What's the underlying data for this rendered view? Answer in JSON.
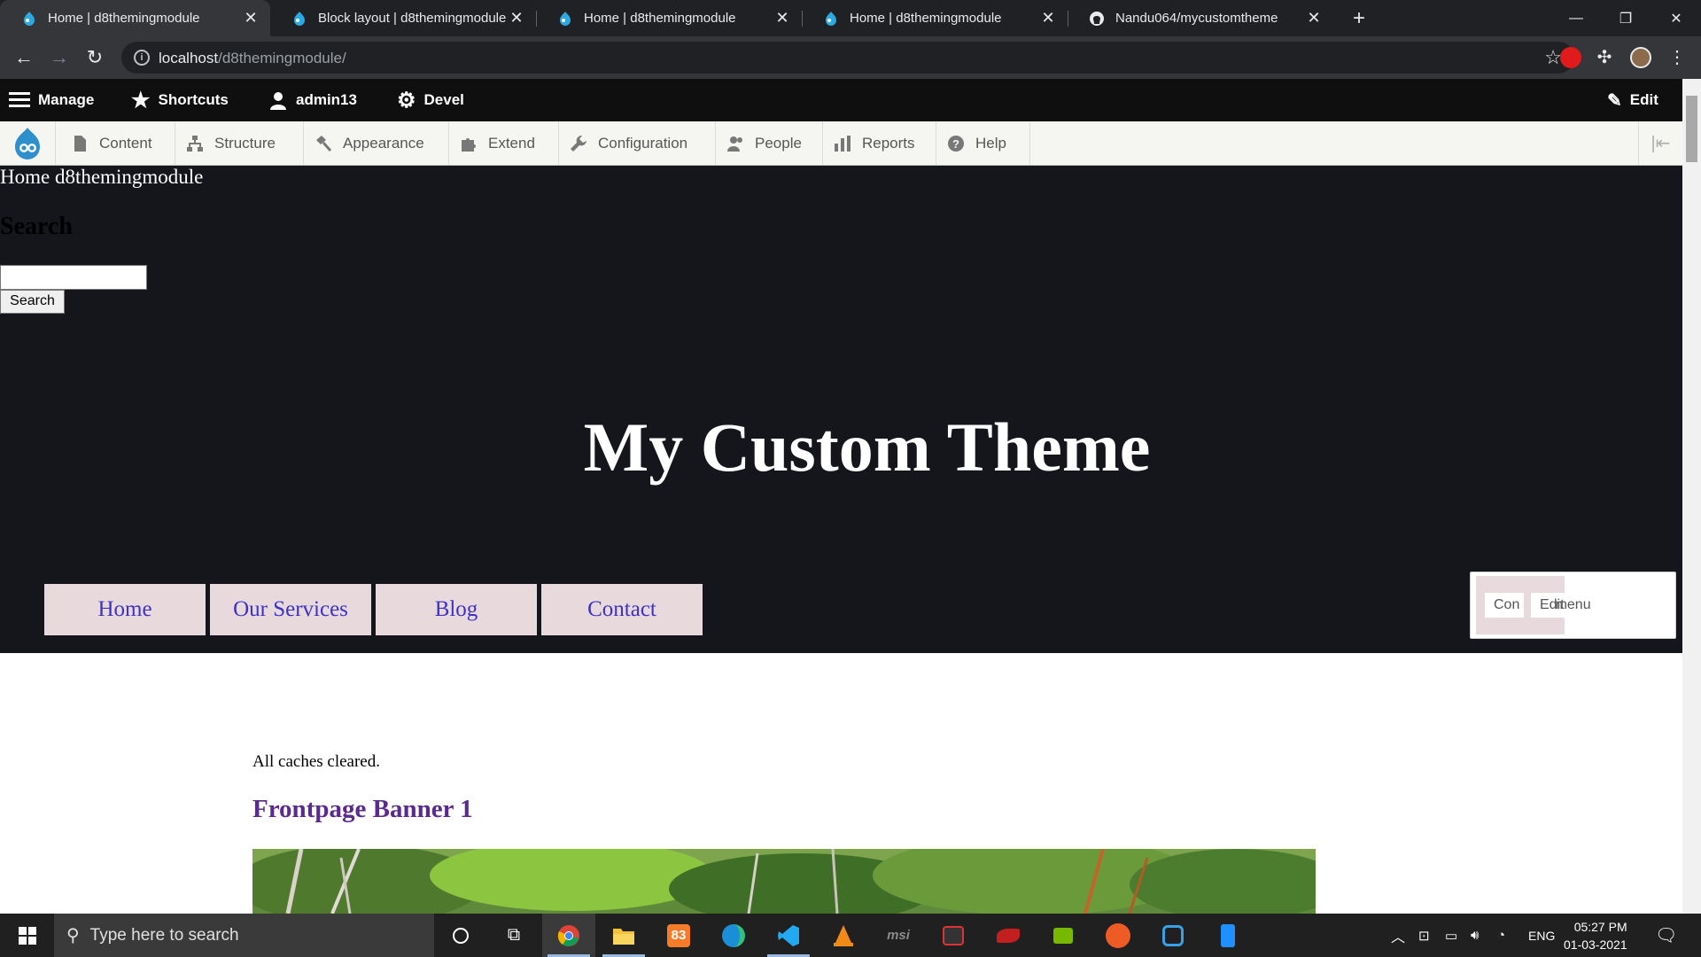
{
  "browser": {
    "tabs": [
      {
        "title": "Home | d8themingmodule",
        "active": true
      },
      {
        "title": "Block layout | d8themingmodule",
        "active": false
      },
      {
        "title": "Home | d8themingmodule",
        "active": false
      },
      {
        "title": "Home | d8themingmodule",
        "active": false
      },
      {
        "title": "Nandu064/mycustomtheme",
        "active": false
      }
    ],
    "url_host": "localhost",
    "url_path": "/d8themingmodule/"
  },
  "admin_toolbar": {
    "manage": "Manage",
    "shortcuts": "Shortcuts",
    "user": "admin13",
    "devel": "Devel",
    "edit": "Edit"
  },
  "admin_tray": {
    "items": [
      "Content",
      "Structure",
      "Appearance",
      "Extend",
      "Configuration",
      "People",
      "Reports",
      "Help"
    ]
  },
  "page": {
    "logo_alt": "Home d8themingmodule",
    "search_heading": "Search",
    "search_button": "Search",
    "site_title": "My Custom Theme",
    "menu": [
      "Home",
      "Our Services",
      "Blog",
      "Contact"
    ],
    "contextual": {
      "btn1": "Con",
      "btn2": "Edit",
      "btn2_overlap": "menu"
    },
    "status_message": "All caches cleared.",
    "banner_title": "Frontpage Banner 1"
  },
  "taskbar": {
    "search_placeholder": "Type here to search",
    "language": "ENG",
    "time": "05:27 PM",
    "date": "01-03-2021"
  },
  "colors": {
    "header_bg": "#14161c",
    "menu_bg": "#e8dadc",
    "menu_link": "#3d31c9",
    "banner_title": "#5a2a8f"
  }
}
